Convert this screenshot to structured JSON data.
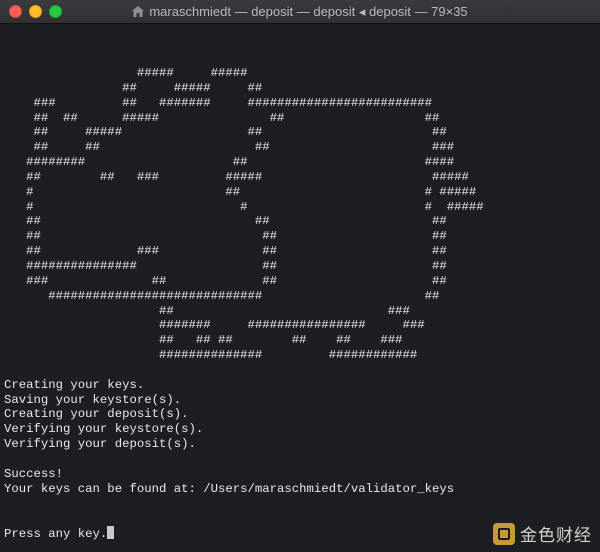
{
  "window": {
    "title": "maraschmiedt — deposit — deposit ◂ deposit — 79×35"
  },
  "terminal": {
    "art": [
      "                  #####     #####",
      "                ##     #####     ##",
      "    ###         ##   #######     #########################",
      "    ##  ##      #####               ##                   ##",
      "    ##     #####                 ##                       ##",
      "    ##     ##                     ##                      ###",
      "   ########                    ##                        ####",
      "   ##        ##   ###         #####                       #####",
      "   #                          ##                         # #####",
      "   #                            #                        #  #####",
      "   ##                             ##                      ##",
      "   ##                              ##                     ##",
      "   ##             ###              ##                     ##",
      "   ###############                 ##                     ##",
      "   ###              ##             ##                     ##",
      "      #############################                      ##",
      "                     ##                             ###",
      "                     #######     ################     ###",
      "                     ##   ## ##        ##    ##    ###",
      "                     ##############         ############"
    ],
    "output": [
      "",
      "Creating your keys.",
      "Saving your keystore(s).",
      "Creating your deposit(s).",
      "Verifying your keystore(s).",
      "Verifying your deposit(s).",
      "",
      "Success!",
      "Your keys can be found at: /Users/maraschmiedt/validator_keys",
      "",
      "",
      "Press any key."
    ]
  },
  "watermark": {
    "text": "金色财经"
  }
}
